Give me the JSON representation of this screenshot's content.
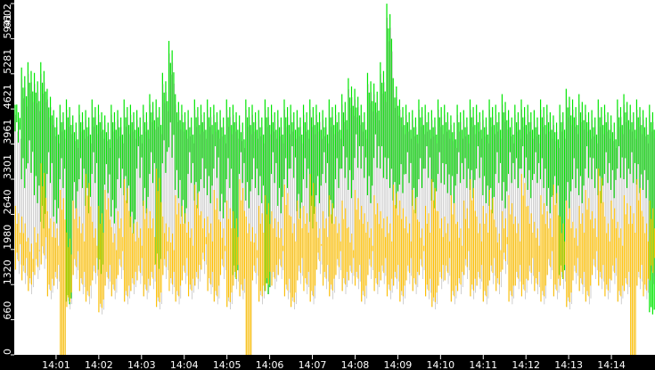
{
  "chart_data": {
    "type": "bar",
    "title": "",
    "xlabel": "",
    "ylabel": "",
    "ylim": [
      0,
      6602
    ],
    "xlim_minutes": [
      0,
      15
    ],
    "y_ticks": [
      "0",
      "660",
      "1320",
      "1980",
      "2640",
      "3301",
      "3961",
      "4621",
      "5281",
      "5941",
      "6602"
    ],
    "x_ticks": [
      "14:01",
      "14:02",
      "14:03",
      "14:04",
      "14:05",
      "14:06",
      "14:07",
      "14:08",
      "14:09",
      "14:10",
      "14:11",
      "14:12",
      "14:13",
      "14:14"
    ],
    "sample_interval_minutes": 0.15,
    "colors": {
      "green": "#00e600",
      "yellow": "#ffc000",
      "grey": "#a0a0a0",
      "axis": "#000000"
    },
    "series": [
      {
        "name": "green_high",
        "values": [
          4700,
          5400,
          5500,
          5300,
          5500,
          5000,
          4600,
          4700,
          4800,
          4500,
          4700,
          4600,
          4800,
          4700,
          4500,
          4700,
          4600,
          4800,
          4700,
          4600,
          4700,
          4900,
          4800,
          5300,
          5900,
          4900,
          4700,
          4600,
          4800,
          4700,
          4800,
          4700,
          4600,
          4800,
          4700,
          4500,
          4800,
          4700,
          4600,
          4800,
          4700,
          4600,
          4800,
          4700,
          4600,
          4700,
          4800,
          4700,
          4600,
          4800,
          4700,
          4900,
          5200,
          5000,
          4700,
          5300,
          5100,
          5500,
          6600,
          5200,
          4800,
          4700,
          4600,
          4800,
          4700,
          4600,
          4800,
          4700,
          4500,
          4700,
          4600,
          4800,
          4700,
          4600,
          4800,
          4700,
          4900,
          4600,
          4700,
          4800,
          4700,
          4600,
          4800,
          4700,
          4500,
          4700,
          5000,
          4800,
          4900,
          4700,
          4600,
          4800,
          4700,
          4500,
          4800,
          4900,
          4700,
          4800,
          4600,
          4700
        ]
      },
      {
        "name": "green_low",
        "values": [
          4200,
          3300,
          3600,
          3000,
          2500,
          3400,
          2600,
          3300,
          1000,
          2900,
          3300,
          2800,
          3400,
          1600,
          3200,
          2600,
          3300,
          3000,
          2400,
          3500,
          2800,
          3400,
          1700,
          3600,
          3900,
          3100,
          2600,
          3400,
          2900,
          3300,
          3000,
          3500,
          2700,
          3300,
          1500,
          3400,
          2900,
          3300,
          3000,
          1200,
          3400,
          2800,
          3300,
          3500,
          2700,
          3300,
          2500,
          3000,
          3400,
          2600,
          3300,
          3500,
          3100,
          3700,
          3500,
          3000,
          3700,
          3500,
          3300,
          2900,
          3200,
          3400,
          2800,
          3300,
          3500,
          2900,
          3400,
          3200,
          3000,
          3400,
          3300,
          3100,
          3500,
          3000,
          2800,
          3400,
          2900,
          3400,
          3300,
          3500,
          3100,
          3400,
          3300,
          2800,
          3000,
          1500,
          2900,
          3300,
          3000,
          3500,
          3300,
          3000,
          3400,
          3100,
          3500,
          3300,
          3400,
          3200,
          3100,
          800
        ]
      },
      {
        "name": "yellow_high",
        "values": [
          2800,
          2600,
          2200,
          2400,
          3600,
          2700,
          2500,
          3100,
          2300,
          2900,
          2600,
          3400,
          2500,
          2800,
          3100,
          2400,
          2700,
          3300,
          2600,
          2500,
          2900,
          2700,
          3500,
          2600,
          2400,
          3000,
          2800,
          2500,
          3200,
          2700,
          2600,
          3100,
          2500,
          2900,
          2700,
          3300,
          2600,
          2400,
          2800,
          3000,
          2700,
          2500,
          3200,
          2600,
          2900,
          2800,
          3400,
          2500,
          2700,
          3000,
          2600,
          2900,
          2400,
          3100,
          2800,
          2500,
          3000,
          2700,
          2600,
          3200,
          2900,
          2600,
          3100,
          2500,
          2800,
          3300,
          2700,
          2600,
          3000,
          2500,
          2900,
          3300,
          2600,
          2800,
          3100,
          2400,
          2700,
          3000,
          2600,
          3400,
          2800,
          2500,
          3000,
          2700,
          3200,
          2600,
          2900,
          2500,
          2800,
          3100,
          2700,
          3500,
          2600,
          2900,
          2500,
          3000,
          2800,
          3300,
          2600,
          2900
        ]
      },
      {
        "name": "yellow_low",
        "values": [
          1600,
          1400,
          1200,
          1500,
          1700,
          1100,
          1300,
          0,
          900,
          1500,
          1200,
          1000,
          1400,
          800,
          1300,
          1100,
          1500,
          1000,
          1200,
          1400,
          1100,
          1300,
          900,
          1500,
          1200,
          1000,
          1400,
          1100,
          1300,
          1600,
          1200,
          1000,
          1500,
          900,
          1300,
          1100,
          0,
          1400,
          1000,
          1200,
          1300,
          1500,
          1100,
          900,
          1400,
          1200,
          1000,
          1600,
          1300,
          1100,
          1500,
          1200,
          1400,
          1300,
          1000,
          1500,
          1200,
          1400,
          1100,
          1300,
          1000,
          1400,
          1200,
          1500,
          1100,
          900,
          1300,
          1400,
          1000,
          1200,
          1500,
          1100,
          1300,
          1000,
          1400,
          1200,
          1600,
          1000,
          1300,
          1100,
          1400,
          1200,
          1000,
          1500,
          1100,
          1300,
          900,
          1400,
          1200,
          1000,
          1500,
          1300,
          1100,
          1400,
          1000,
          1200,
          0,
          1300,
          1100,
          1400
        ]
      }
    ],
    "grid": false,
    "legend": "none"
  }
}
